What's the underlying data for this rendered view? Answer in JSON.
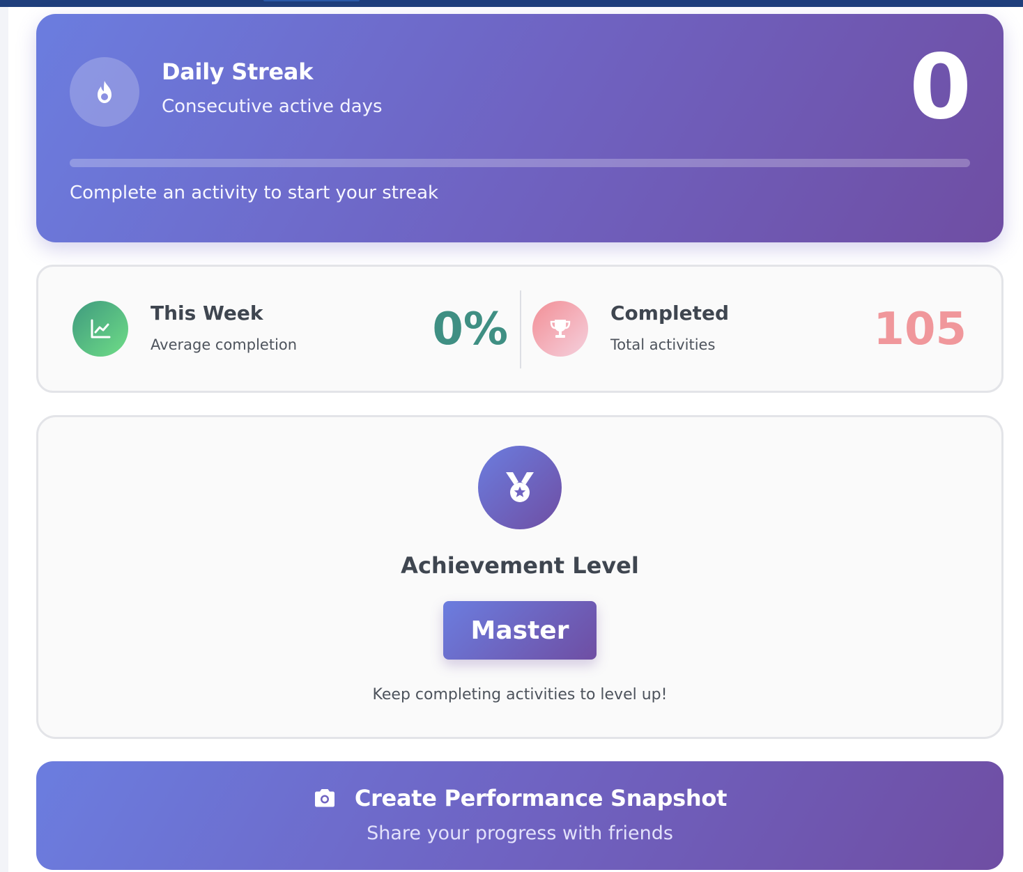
{
  "streak": {
    "title": "Daily Streak",
    "subtitle": "Consecutive active days",
    "count": "0",
    "progress_fraction": 0,
    "message": "Complete an activity to start your streak",
    "icon": "flame-icon"
  },
  "stats": {
    "week": {
      "title": "This Week",
      "subtitle": "Average completion",
      "value": "0%",
      "icon": "chart-line-icon",
      "color": "#3f8f83"
    },
    "completed": {
      "title": "Completed",
      "subtitle": "Total activities",
      "value": "105",
      "icon": "trophy-icon",
      "color": "#f0979b"
    }
  },
  "achievement": {
    "title": "Achievement Level",
    "level": "Master",
    "hint": "Keep completing activities to level up!",
    "icon": "medal-icon"
  },
  "snapshot": {
    "title": "Create Performance Snapshot",
    "subtitle": "Share your progress with friends",
    "icon": "camera-icon"
  },
  "colors": {
    "accent_start": "#6b7ddf",
    "accent_end": "#6f4ea3",
    "top_bar": "#1f3f7c"
  }
}
